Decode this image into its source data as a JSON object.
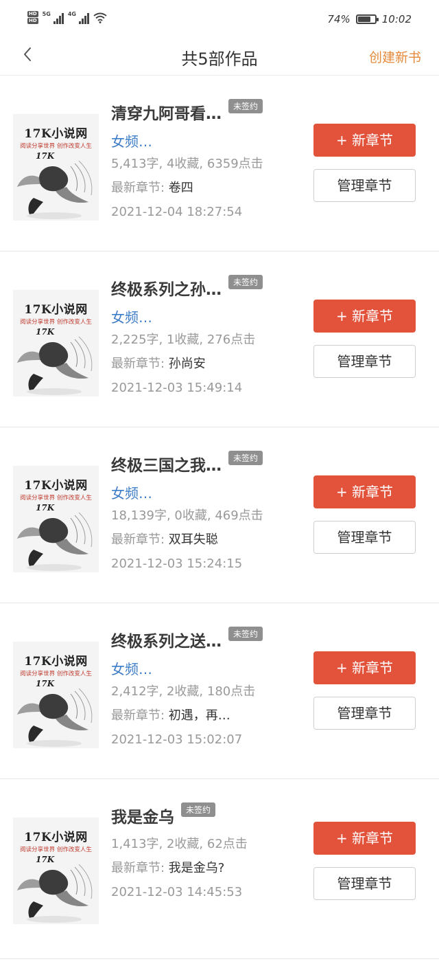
{
  "status_bar": {
    "hd1": "HD",
    "hd2": "HD",
    "net1": "5G",
    "net2": "4G",
    "battery_text": "74%",
    "battery_level": 0.74,
    "time": "10:02"
  },
  "header": {
    "back_icon": "chevron-left-icon",
    "title": "共5部作品",
    "create_label": "创建新书"
  },
  "cover": {
    "brand": "17K小说网",
    "slogan": "阅读分享世界 创作改变人生",
    "logo": "17K"
  },
  "labels": {
    "new_chapter": "+ 新章节",
    "manage_chapter": "管理章节",
    "latest_prefix": "最新章节: "
  },
  "books": [
    {
      "title": "清穿九阿哥看…",
      "badge": "未签约",
      "category": "女频…",
      "stats": "5,413字, 4收藏, 6359点击",
      "latest": "卷四",
      "date": "2021-12-04 18:27:54"
    },
    {
      "title": "终极系列之孙…",
      "badge": "未签约",
      "category": "女频…",
      "stats": "2,225字, 1收藏, 276点击",
      "latest": "孙尚安",
      "date": "2021-12-03 15:49:14"
    },
    {
      "title": "终极三国之我…",
      "badge": "未签约",
      "category": "女频…",
      "stats": "18,139字, 0收藏, 469点击",
      "latest": "双耳失聪",
      "date": "2021-12-03 15:24:15"
    },
    {
      "title": "终极系列之送…",
      "badge": "未签约",
      "category": "女频…",
      "stats": "2,412字, 2收藏, 180点击",
      "latest": "初遇，再…",
      "date": "2021-12-03 15:02:07"
    },
    {
      "title": "我是金乌",
      "badge": "未签约",
      "category": "",
      "stats": "1,413字, 2收藏, 62点击",
      "latest": "我是金乌?",
      "date": "2021-12-03 14:45:53"
    }
  ]
}
